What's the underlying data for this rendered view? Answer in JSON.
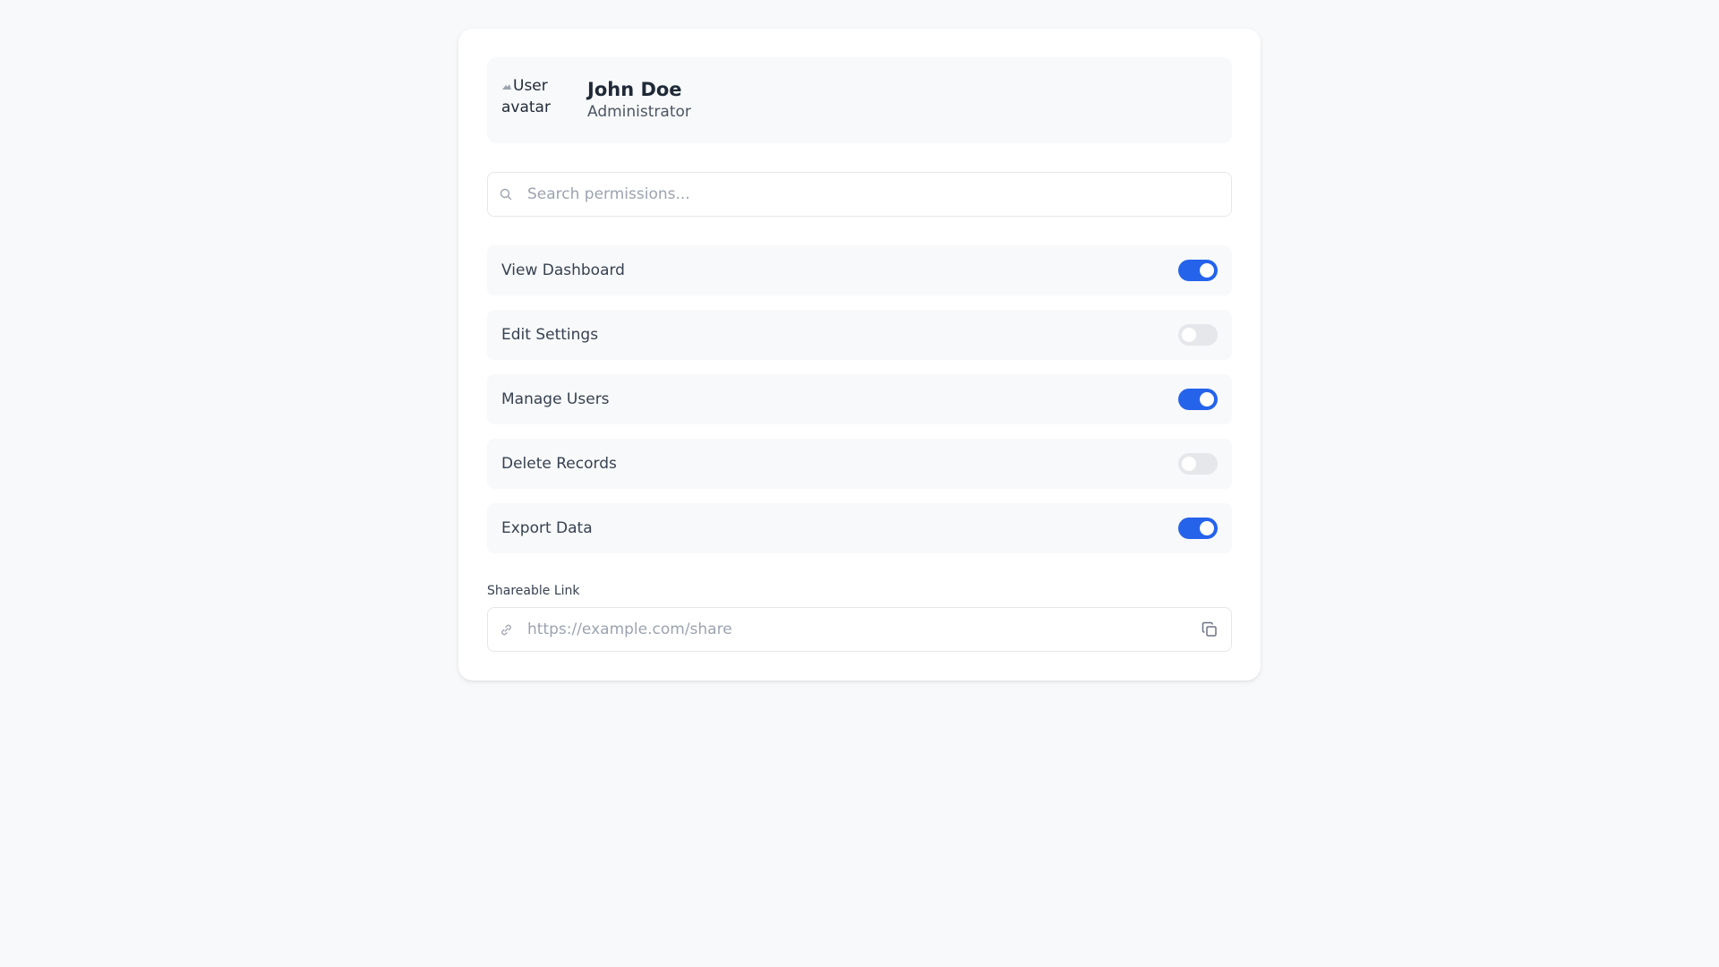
{
  "profile": {
    "avatar_alt": "User avatar",
    "avatar_alt_line1": "User",
    "avatar_alt_line2": "avatar",
    "name": "John Doe",
    "role": "Administrator"
  },
  "search": {
    "placeholder": "Search permissions...",
    "value": "",
    "icon": "search-icon"
  },
  "permissions": [
    {
      "label": "View Dashboard",
      "enabled": true
    },
    {
      "label": "Edit Settings",
      "enabled": false
    },
    {
      "label": "Manage Users",
      "enabled": true
    },
    {
      "label": "Delete Records",
      "enabled": false
    },
    {
      "label": "Export Data",
      "enabled": true
    }
  ],
  "share": {
    "label": "Shareable Link",
    "placeholder": "https://example.com/share",
    "value": "",
    "link_icon": "link-icon",
    "copy_icon": "copy-icon"
  },
  "colors": {
    "accent": "#2563eb",
    "toggle_off": "#e5e7eb",
    "background": "#f8f9fb"
  }
}
